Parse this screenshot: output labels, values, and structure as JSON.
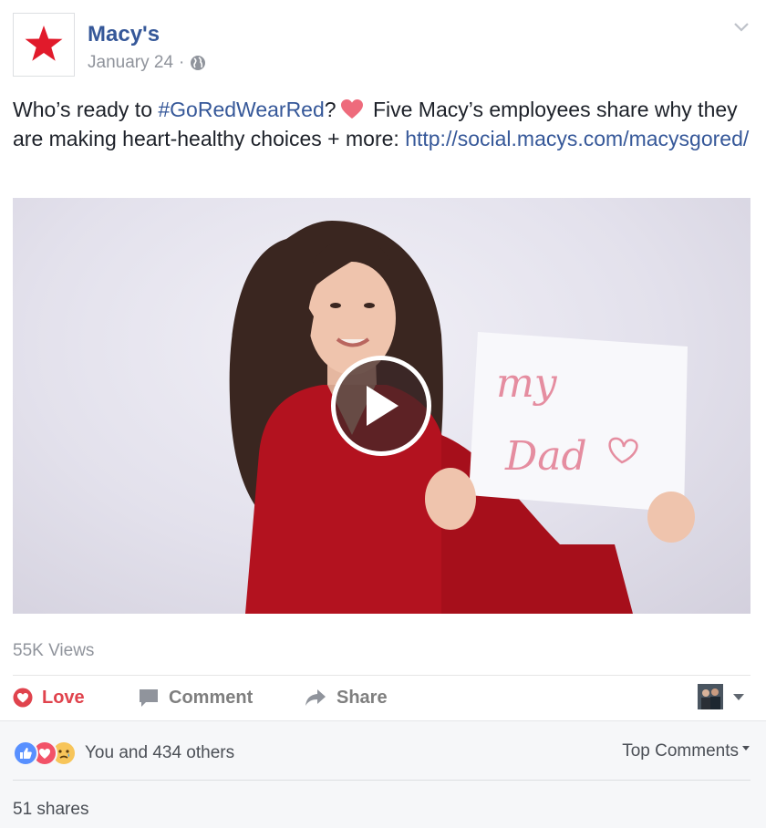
{
  "page": {
    "name": "Macy's",
    "date": "January 24",
    "separator": "·",
    "brand_color": "#e11a2b"
  },
  "post": {
    "text_part1": "Who’s ready to ",
    "hashtag": "#GoRedWearRed",
    "text_part2": "?",
    "text_part3": " Five Macy’s employees share why they are making heart-healthy choices + more: ",
    "link": "http://social.macys.com/macysgored/",
    "sign_line1": "my",
    "sign_line2": "Dad"
  },
  "stats": {
    "views": "55K Views",
    "reactions_text": "You and 434 others",
    "shares": "51 shares"
  },
  "actions": {
    "love": "Love",
    "comment": "Comment",
    "share": "Share"
  },
  "comments": {
    "sort_label": "Top Comments"
  },
  "colors": {
    "link": "#365899",
    "love": "#e0434d",
    "like_blue": "#5890ff"
  }
}
